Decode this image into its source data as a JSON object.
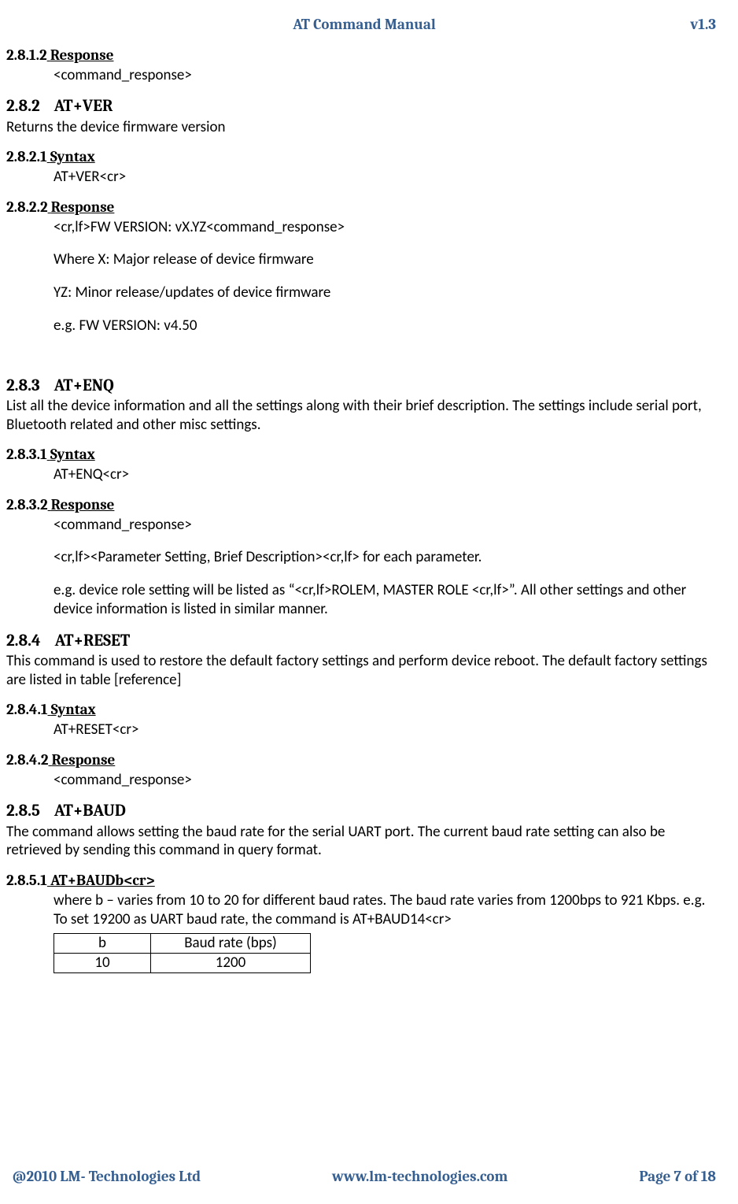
{
  "header": {
    "title": "AT Command Manual",
    "version": "v1.3"
  },
  "footer": {
    "left": "@2010 LM- Technologies Ltd",
    "center": "www.lm-technologies.com",
    "right": "Page 7 of 18"
  },
  "s2812": {
    "num": "2.8.1.2",
    "title": "Response",
    "body": "<command_response>"
  },
  "s282": {
    "num": "2.8.2",
    "title": "AT+VER",
    "desc": "Returns the device firmware version"
  },
  "s2821": {
    "num": "2.8.2.1",
    "title": "Syntax",
    "body": "AT+VER<cr>"
  },
  "s2822": {
    "num": "2.8.2.2",
    "title": "Response",
    "l1": "<cr,lf>FW  VERSION: vX.YZ<command_response>",
    "l2": "Where X: Major release of device firmware",
    "l3": "YZ: Minor release/updates of device firmware",
    "l4": "e.g. FW VERSION:  v4.50"
  },
  "s283": {
    "num": "2.8.3",
    "title": "AT+ENQ",
    "desc": "List all the device information and all the settings along with their brief description. The settings include serial port, Bluetooth related and other misc settings."
  },
  "s2831": {
    "num": "2.8.3.1",
    "title": "Syntax",
    "body": "AT+ENQ<cr>"
  },
  "s2832": {
    "num": "2.8.3.2",
    "title": "Response",
    "l1": "<command_response>",
    "l2": "<cr,lf><Parameter Setting, Brief Description><cr,lf> for each parameter.",
    "l3": "e.g. device role setting will be listed as “<cr,lf>ROLEM, MASTER ROLE <cr,lf>”. All other settings and other device information is listed in similar manner."
  },
  "s284": {
    "num": "2.8.4",
    "title": "AT+RESET",
    "desc": "This command is used to restore the default factory settings and perform device reboot. The default factory settings are listed in table [reference]"
  },
  "s2841": {
    "num": "2.8.4.1",
    "title": "Syntax",
    "body": "AT+RESET<cr>"
  },
  "s2842": {
    "num": "2.8.4.2",
    "title": "Response",
    "body": "<command_response>"
  },
  "s285": {
    "num": "2.8.5",
    "title": "AT+BAUD",
    "desc": "The command allows setting the baud rate for the serial UART port.  The current baud rate setting can also be retrieved by sending this command in query format."
  },
  "s2851": {
    "num": "2.8.5.1",
    "title": "AT+BAUDb<cr>",
    "body": "where b – varies from 10 to 20 for different baud rates. The baud rate varies from 1200bps to 921 Kbps. e.g. To set 19200 as UART baud rate, the command is AT+BAUD14<cr>"
  },
  "table": {
    "h1": "b",
    "h2": "Baud rate (bps)",
    "r1c1": "10",
    "r1c2": "1200"
  }
}
